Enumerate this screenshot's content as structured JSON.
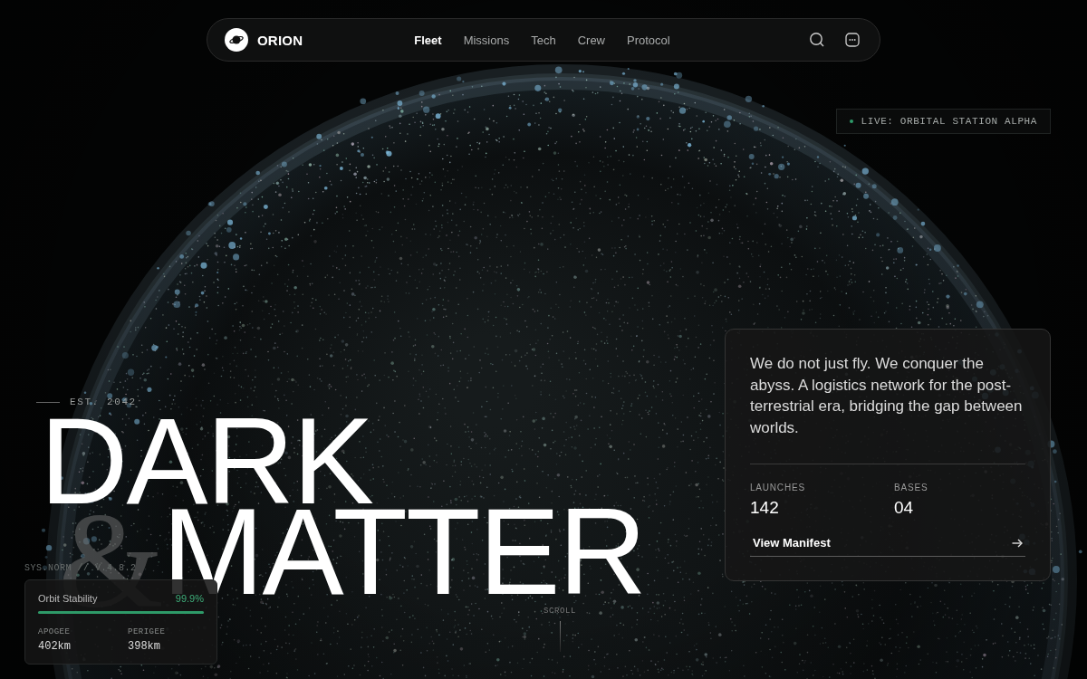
{
  "brand": {
    "name": "ORION"
  },
  "nav": [
    {
      "label": "Fleet",
      "selected": true
    },
    {
      "label": "Missions",
      "selected": false
    },
    {
      "label": "Tech",
      "selected": false
    },
    {
      "label": "Crew",
      "selected": false
    },
    {
      "label": "Protocol",
      "selected": false
    }
  ],
  "badge": {
    "text": "LIVE: ORBITAL STATION ALPHA"
  },
  "hero": {
    "est": "EST. 2042",
    "title_line1": "DARK",
    "title_line2": "MATTER",
    "ampersand": "&"
  },
  "card": {
    "text": "We do not just fly. We conquer the abyss. A logistics network for the post-terrestrial era, bridging the gap between worlds.",
    "stats": [
      {
        "label": "LAUNCHES",
        "value": "142"
      },
      {
        "label": "BASES",
        "value": "04"
      }
    ],
    "link": "View Manifest"
  },
  "system": {
    "version": "SYS.NORM // V.4.8.2",
    "metric": {
      "label": "Orbit Stability",
      "reading": "99.9%",
      "level": 0.999
    },
    "stats": [
      {
        "label": "APOGEE",
        "value": "402km"
      },
      {
        "label": "PERIGEE",
        "value": "398km"
      }
    ]
  },
  "scroll": {
    "label": "SCROLL"
  }
}
